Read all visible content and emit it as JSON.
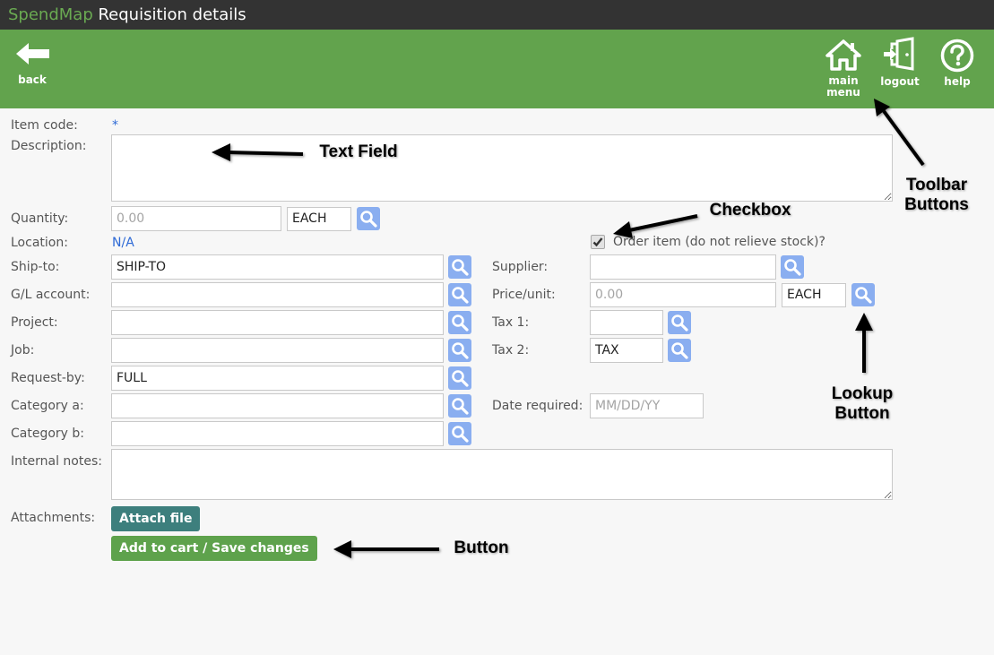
{
  "window": {
    "brand": "SpendMap",
    "title": "Requisition details"
  },
  "toolbar": {
    "back": {
      "label": "back",
      "icon": "arrow-left-icon"
    },
    "main_menu": {
      "label": "main\nmenu",
      "icon": "home-icon"
    },
    "logout": {
      "label": "logout",
      "icon": "logout-door-icon"
    },
    "help": {
      "label": "help",
      "icon": "help-circle-icon"
    }
  },
  "form": {
    "item_code": {
      "label": "Item code:",
      "value": "*"
    },
    "description": {
      "label": "Description:",
      "value": ""
    },
    "quantity": {
      "label": "Quantity:",
      "placeholder": "0.00",
      "unit": "EACH"
    },
    "location": {
      "label": "Location:",
      "value": "N/A"
    },
    "order_item": {
      "label": "Order item (do not relieve stock)?",
      "checked": true
    },
    "ship_to": {
      "label": "Ship-to:",
      "value": "SHIP-TO"
    },
    "gl_account": {
      "label": "G/L account:",
      "value": ""
    },
    "project": {
      "label": "Project:",
      "value": ""
    },
    "job": {
      "label": "Job:",
      "value": ""
    },
    "request_by": {
      "label": "Request-by:",
      "value": "FULL"
    },
    "category_a": {
      "label": "Category a:",
      "value": ""
    },
    "category_b": {
      "label": "Category b:",
      "value": ""
    },
    "internal_notes": {
      "label": "Internal notes:",
      "value": ""
    },
    "supplier": {
      "label": "Supplier:",
      "value": ""
    },
    "price_unit": {
      "label": "Price/unit:",
      "placeholder": "0.00",
      "unit": "EACH"
    },
    "tax1": {
      "label": "Tax 1:",
      "value": ""
    },
    "tax2": {
      "label": "Tax 2:",
      "value": "TAX"
    },
    "date_required": {
      "label": "Date required:",
      "placeholder": "MM/DD/YY"
    },
    "attachments": {
      "label": "Attachments:",
      "button": "Attach file"
    },
    "save_button": "Add to cart / Save changes"
  },
  "annotations": {
    "text_field": "Text Field",
    "checkbox": "Checkbox",
    "toolbar_buttons": "Toolbar\nButtons",
    "lookup_button": "Lookup\nButton",
    "button": "Button"
  },
  "colors": {
    "titlebar": "#333333",
    "brand": "#6aaa52",
    "toolbar": "#62a34d",
    "link": "#2e6ad6",
    "lookup": "#8aaef0",
    "attach_button": "#3d7f7d",
    "save_button": "#5ea24c"
  }
}
